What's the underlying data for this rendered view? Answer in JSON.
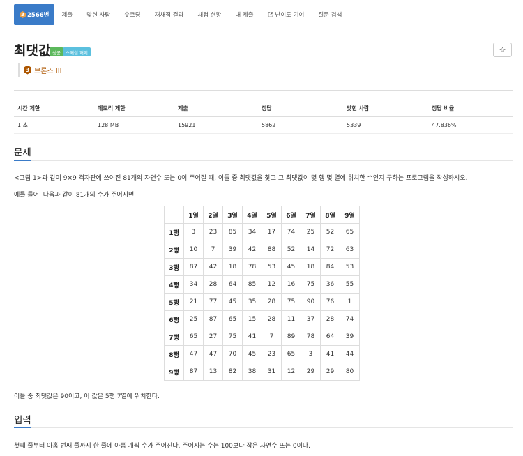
{
  "tabs": [
    {
      "tier": "3",
      "label": "2566번",
      "active": true
    },
    {
      "label": "제출"
    },
    {
      "label": "맞힌 사람"
    },
    {
      "label": "숏코딩"
    },
    {
      "label": "재채점 결과"
    },
    {
      "label": "채점 현황"
    },
    {
      "label": "내 제출"
    },
    {
      "label": "난이도 기여",
      "icon": "external-link-icon"
    },
    {
      "label": "질문 검색"
    }
  ],
  "problem": {
    "title": "최댓값",
    "badge_success": "성공",
    "badge_special": "스페셜 저지",
    "star": "☆",
    "tier_num": "3",
    "tier_label": "브론즈 III"
  },
  "info_table": {
    "headers": [
      "시간 제한",
      "메모리 제한",
      "제출",
      "정답",
      "맞힌 사람",
      "정답 비율"
    ],
    "values": [
      "1 초",
      "128 MB",
      "15921",
      "5862",
      "5339",
      "47.836%"
    ]
  },
  "sections": {
    "problem_title": "문제",
    "problem_p1": "<그림 1>과 같이 9×9 격자판에 쓰여진 81개의 자연수 또는 0이 주어질 때, 이들 중 최댓값을 찾고 그 최댓값이 몇 행 몇 열에 위치한 수인지 구하는 프로그램을 작성하시오.",
    "problem_p2": "예를 들어, 다음과 같이 81개의 수가 주어지면",
    "problem_p3": "이들 중 최댓값은 90이고, 이 값은 5행 7열에 위치한다.",
    "input_title": "입력",
    "input_p1": "첫째 줄부터 아홉 번째 줄까지 한 줄에 아홉 개씩 수가 주어진다. 주어지는 수는 100보다 작은 자연수 또는 0이다."
  },
  "grid": {
    "col_headers": [
      "1열",
      "2열",
      "3열",
      "4열",
      "5열",
      "6열",
      "7열",
      "8열",
      "9열"
    ],
    "rows": [
      {
        "label": "1행",
        "values": [
          "3",
          "23",
          "85",
          "34",
          "17",
          "74",
          "25",
          "52",
          "65"
        ]
      },
      {
        "label": "2행",
        "values": [
          "10",
          "7",
          "39",
          "42",
          "88",
          "52",
          "14",
          "72",
          "63"
        ]
      },
      {
        "label": "3행",
        "values": [
          "87",
          "42",
          "18",
          "78",
          "53",
          "45",
          "18",
          "84",
          "53"
        ]
      },
      {
        "label": "4행",
        "values": [
          "34",
          "28",
          "64",
          "85",
          "12",
          "16",
          "75",
          "36",
          "55"
        ]
      },
      {
        "label": "5행",
        "values": [
          "21",
          "77",
          "45",
          "35",
          "28",
          "75",
          "90",
          "76",
          "1"
        ]
      },
      {
        "label": "6행",
        "values": [
          "25",
          "87",
          "65",
          "15",
          "28",
          "11",
          "37",
          "28",
          "74"
        ]
      },
      {
        "label": "7행",
        "values": [
          "65",
          "27",
          "75",
          "41",
          "7",
          "89",
          "78",
          "64",
          "39"
        ]
      },
      {
        "label": "8행",
        "values": [
          "47",
          "47",
          "70",
          "45",
          "23",
          "65",
          "3",
          "41",
          "44"
        ]
      },
      {
        "label": "9행",
        "values": [
          "87",
          "13",
          "82",
          "38",
          "31",
          "12",
          "29",
          "29",
          "80"
        ]
      }
    ]
  },
  "colors": {
    "accent": "#3a7bc8",
    "bronze": "#ad5600",
    "success": "#5cb85c",
    "info": "#5bc0de"
  }
}
